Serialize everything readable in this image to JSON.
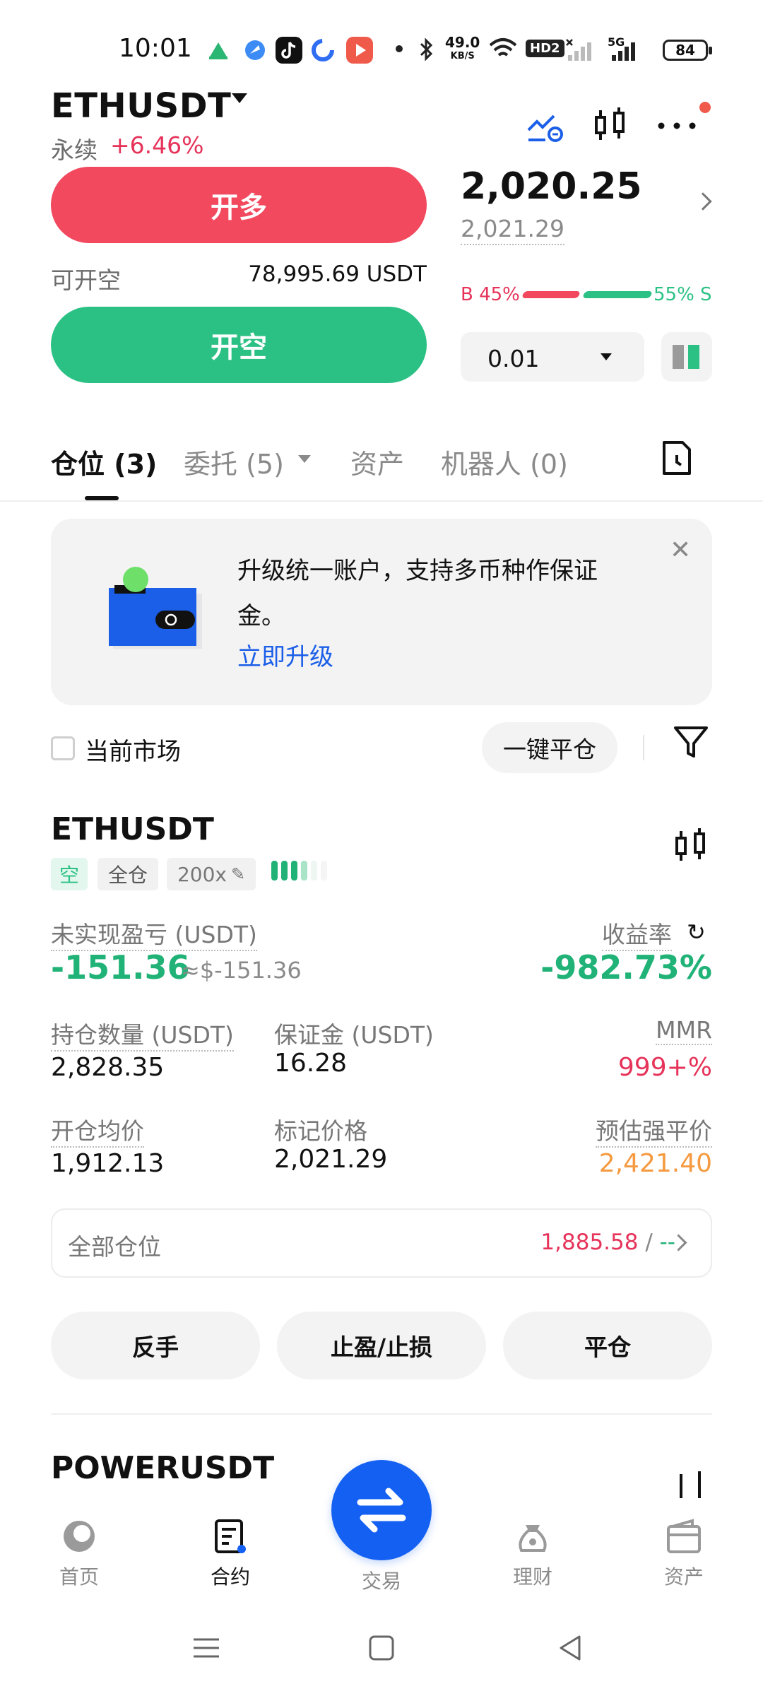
{
  "status_bar": {
    "time": "10:01",
    "net_speed_value": "49.0",
    "net_speed_unit": "KB/S",
    "hd_label": "HD2",
    "network": "5G",
    "battery": "84"
  },
  "header": {
    "symbol": "ETHUSDT",
    "contract_type": "永续",
    "change_pct": "+6.46%",
    "icons": [
      "chart-trend-icon",
      "candlestick-icon",
      "more-icon"
    ]
  },
  "order_panel": {
    "long_button": "开多",
    "short_button": "开空",
    "available_label": "可开空",
    "available_value": "78,995.69 USDT",
    "last_price": "2,020.25",
    "mark_price": "2,021.29",
    "buy_ratio_label": "B 45%",
    "sell_ratio_label": "55% S",
    "buy_ratio": 0.45,
    "sell_ratio": 0.55,
    "quantity": "0.01"
  },
  "tabs": [
    {
      "label": "仓位 (3)",
      "active": true
    },
    {
      "label": "委托 (5)",
      "active": false
    },
    {
      "label": "资产",
      "active": false
    },
    {
      "label": "机器人 (0)",
      "active": false
    }
  ],
  "banner": {
    "text": "升级统一账户，支持多币种作保证金。",
    "link": "立即升级"
  },
  "filter": {
    "current_market_label": "当前市场",
    "close_all_button": "一键平仓"
  },
  "position": {
    "symbol": "ETHUSDT",
    "side_tag": "空",
    "margin_mode_tag": "全仓",
    "leverage_tag": "200x",
    "unrealized_pnl_label": "未实现盈亏 (USDT)",
    "unrealized_pnl": "-151.36",
    "unrealized_pnl_approx": "≈$-151.36",
    "roe_label": "收益率",
    "roe": "-982.73%",
    "size_label": "持仓数量 (USDT)",
    "size": "2,828.35",
    "margin_label": "保证金 (USDT)",
    "margin": "16.28",
    "mmr_label": "MMR",
    "mmr": "999+%",
    "entry_label": "开仓均价",
    "entry": "1,912.13",
    "mark_label": "标记价格",
    "mark": "2,021.29",
    "liq_label": "预估强平价",
    "liq": "2,421.40",
    "all_positions_label": "全部仓位",
    "all_positions_value": "1,885.58",
    "all_positions_sep": " / ",
    "all_positions_extra": "--",
    "actions": [
      "反手",
      "止盈/止损",
      "平仓"
    ]
  },
  "position2": {
    "symbol": "POWERUSDT"
  },
  "bottom_nav": [
    {
      "label": "首页",
      "icon": "home-icon",
      "active": false
    },
    {
      "label": "合约",
      "icon": "contract-icon",
      "active": true
    },
    {
      "label": "交易",
      "icon": "swap-icon",
      "active": false
    },
    {
      "label": "理财",
      "icon": "finance-icon",
      "active": false
    },
    {
      "label": "资产",
      "icon": "wallet-icon",
      "active": false
    }
  ],
  "colors": {
    "long": "#f2495f",
    "short": "#2bc184",
    "accent": "#1460f2",
    "liq": "#f59a40"
  }
}
